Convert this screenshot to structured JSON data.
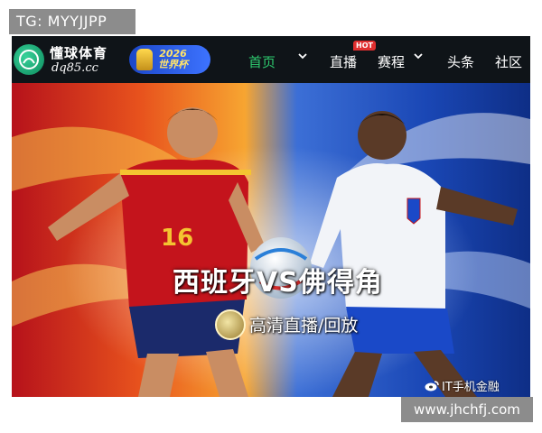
{
  "watermark_top": "TG: MYYJJPP",
  "watermark_bottom": "www.jhchfj.com",
  "brand": {
    "name": "懂球体育",
    "url": "dq85.cc",
    "wc_year": "2026",
    "wc_label": "世界杯"
  },
  "nav": {
    "items": [
      {
        "label": "首页",
        "active": true
      },
      {
        "label": "直播",
        "badge": "HOT"
      },
      {
        "label": "赛程"
      },
      {
        "label": "头条"
      },
      {
        "label": "社区"
      }
    ]
  },
  "hero": {
    "title": "西班牙VS佛得角",
    "subtitle": "高清直播/回放",
    "left_jersey_number": "16",
    "credit": "IT手机金融"
  },
  "colors": {
    "accent": "#2ecb6f",
    "hot": "#e02f2f",
    "spain_red": "#c4141c",
    "england_white": "#f2f4f8"
  }
}
